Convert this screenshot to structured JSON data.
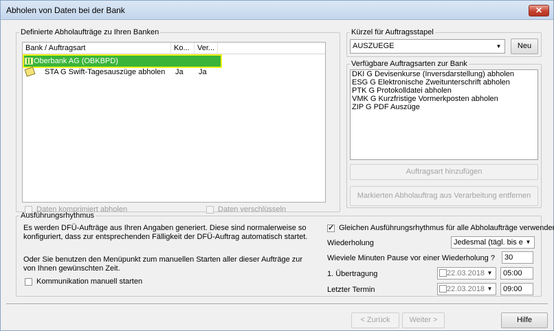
{
  "window": {
    "title": "Abholen von Daten bei der Bank",
    "close_glyph": "✕"
  },
  "left_group": {
    "legend": "Definierte Abholaufträge zu Ihren Banken",
    "columns": [
      "Bank / Auftragsart",
      "Ko...",
      "Ver..."
    ],
    "rows": [
      {
        "name": "Oberbank AG (OBKBPD)",
        "ko": "",
        "ver": "",
        "icon": "bank-icon",
        "selected": true
      },
      {
        "name": "STA G Swift-Tagesauszüge abholen",
        "ko": "Ja",
        "ver": "Ja",
        "icon": "document-icon",
        "selected": false
      }
    ],
    "check_compressed": "Daten komprimiert abholen",
    "check_encrypted": "Daten verschlüsseln"
  },
  "right_top": {
    "legend": "Kürzel für Auftragsstapel",
    "combo_value": "AUSZUEGE",
    "new_button": "Neu"
  },
  "right_list": {
    "legend": "Verfügbare Auftragsarten zur Bank",
    "items": [
      "DKI G Devisenkurse (Inversdarstellung) abholen",
      "ESG G Elektronische Zweitunterschrift abholen",
      "PTK G Protokolldatei abholen",
      "VMK G Kurzfristige Vormerkposten abholen",
      "ZIP G PDF Auszüge"
    ],
    "add_button": "Auftragsart hinzufügen",
    "remove_button": "Markierten Abholauftrag aus Verarbeitung entfernen"
  },
  "schedule": {
    "legend": "Ausführungsrhythmus",
    "para1": "Es werden DFÜ-Aufträge aus Ihren Angaben generiert. Diese sind normalerweise so konfiguriert, dass zur entsprechenden Fälligkeit der DFÜ-Auftrag automatisch startet.",
    "para2": "Oder Sie benutzen den Menüpunkt zum manuellen Starten aller dieser Aufträge zur von Ihnen gewünschten Zeit.",
    "check_manual": "Kommunikation manuell starten",
    "check_same_rhythm": "Gleichen Ausführungsrhythmus für alle Abholaufträge verwenden",
    "repeat_label": "Wiederholung",
    "repeat_value": "Jedesmal (tägl. bis erfolgr",
    "pause_label": "Wieviele Minuten Pause vor einer Wiederholung ?",
    "pause_value": "30",
    "first_label": "1. Übertragung",
    "first_date": "22.03.2018",
    "first_time": "05:00",
    "last_label": "Letzter Termin",
    "last_date": "22.03.2018",
    "last_time": "09:00"
  },
  "footer": {
    "back": "< Zurück",
    "next": "Weiter >",
    "help": "Hilfe"
  }
}
